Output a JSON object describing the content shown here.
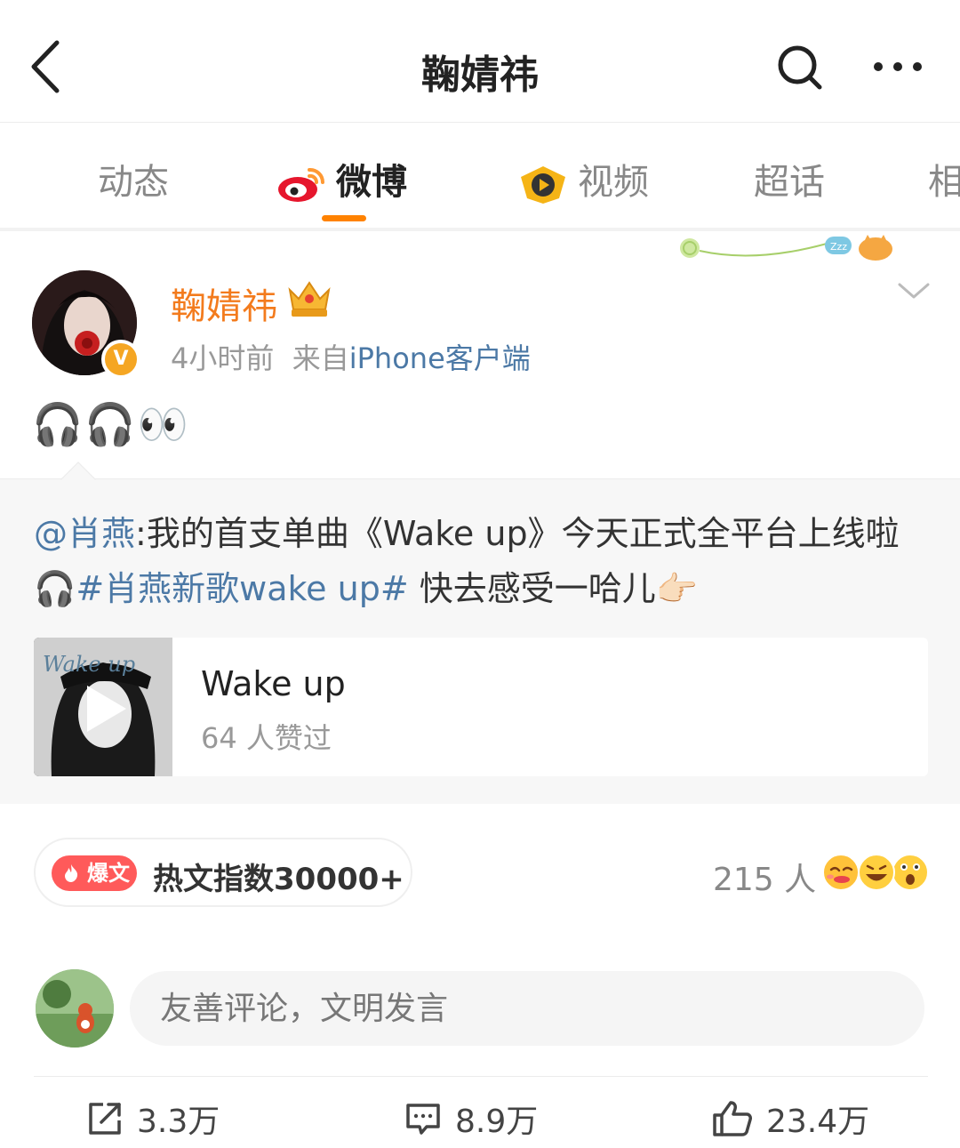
{
  "header": {
    "title": "鞠婧祎"
  },
  "tabs": [
    {
      "label": "动态",
      "active": false
    },
    {
      "label": "微博",
      "active": true
    },
    {
      "label": "视频",
      "active": false
    },
    {
      "label": "超话",
      "active": false
    },
    {
      "label": "相",
      "active": false
    }
  ],
  "post": {
    "author": "鞠婧祎",
    "verified_badge": "V",
    "time": "4小时前",
    "source_prefix": "来自",
    "source": "iPhone客户端",
    "text": "🎧🎧👀"
  },
  "repost": {
    "mention": "@肖燕",
    "text_part1": ":我的首支单曲《Wake up》今天正式全平台上线啦🎧",
    "topic": "#肖燕新歌wake up#",
    "text_part2": " 快去感受一哈儿👉🏻",
    "media": {
      "title": "Wake up",
      "subtitle": "64 人赞过",
      "thumb_text": "Wake up"
    }
  },
  "hot": {
    "badge": "爆文",
    "text": "热文指数30000+"
  },
  "reactions": {
    "count": "215 人"
  },
  "comment": {
    "placeholder": "友善评论，文明发言"
  },
  "actions": {
    "share": "3.3万",
    "comments": "8.9万",
    "likes": "23.4万"
  },
  "colors": {
    "accent": "#ff8200",
    "author": "#f37b1d",
    "link": "#4c79a6",
    "hot_badge": "#ff5a5a"
  }
}
